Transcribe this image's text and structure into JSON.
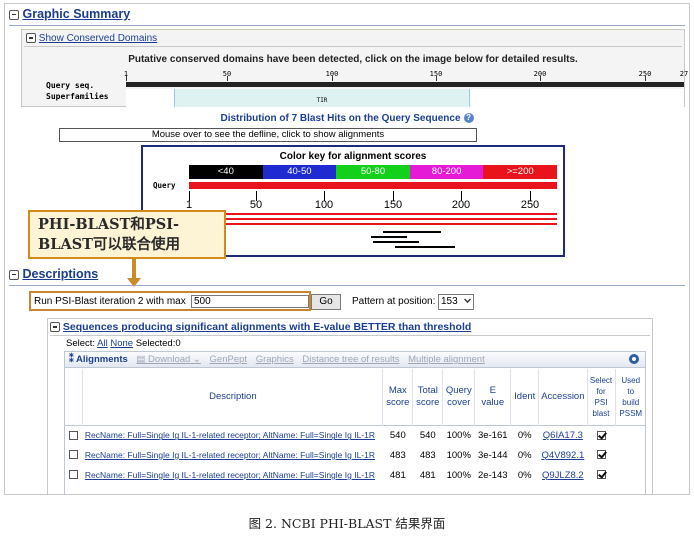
{
  "graphic_summary": {
    "title": "Graphic Summary",
    "show_conserved_domains": "Show Conserved Domains",
    "domains_note": "Putative conserved domains have been detected, click on the image below for detailed results.",
    "query_seq_label": "Query seq.",
    "superfamilies_label": "Superfamilies",
    "ruler_ticks": [
      "1",
      "50",
      "100",
      "150",
      "200",
      "250",
      "27"
    ],
    "domain_label": "TIR",
    "distribution_title": "Distribution of 7 Blast Hits on the Query Sequence",
    "mouseover_note": "Mouse over to see the defline, click to show alignments",
    "color_key_title": "Color key for alignment scores",
    "color_key": [
      {
        "label": "<40",
        "color": "#000000"
      },
      {
        "label": "40-50",
        "color": "#1f2bd1"
      },
      {
        "label": "50-80",
        "color": "#13d11a"
      },
      {
        "label": "80-200",
        "color": "#e41ad6"
      },
      {
        "label": ">=200",
        "color": "#e8131b"
      }
    ],
    "query_label": "Query",
    "axis_ticks": [
      "1",
      "50",
      "100",
      "150",
      "200",
      "250"
    ]
  },
  "callout": {
    "line1": "PHI-BLAST和PSI-",
    "line2": "BLAST可以联合使用"
  },
  "descriptions": {
    "title": "Descriptions",
    "psi_label": "Run PSI-Blast iteration 2 with max",
    "psi_value": "500",
    "go_label": "Go",
    "pattern_label": "Pattern at position:",
    "pattern_value": "153",
    "sequences_heading": "Sequences producing significant alignments with E-value BETTER than threshold",
    "select_label": "Select:",
    "select_all": "All",
    "select_none": "None",
    "selected_count": "Selected:0",
    "toolbar": {
      "alignments": "Alignments",
      "download": "Download",
      "genpept": "GenPept",
      "graphics": "Graphics",
      "distance_tree": "Distance tree of results",
      "multiple_alignment": "Multiple alignment"
    },
    "columns": {
      "description": "Description",
      "max_score_1": "Max",
      "max_score_2": "score",
      "total_score_1": "Total",
      "total_score_2": "score",
      "query_cover_1": "Query",
      "query_cover_2": "cover",
      "e_value_1": "E",
      "e_value_2": "value",
      "ident": "Ident",
      "accession": "Accession",
      "select_psi_1": "Select",
      "select_psi_2": "for",
      "select_psi_3": "PSI",
      "select_psi_4": "blast",
      "used_pssm_1": "Used",
      "used_pssm_2": "to",
      "used_pssm_3": "build",
      "used_pssm_4": "PSSM"
    },
    "rows": [
      {
        "description": "RecName: Full=Single Ig IL-1-related receptor; AltName: Full=Single Ig IL-1R",
        "max_score": "540",
        "total_score": "540",
        "query_cover": "100%",
        "e_value": "3e-161",
        "ident": "0%",
        "accession": "Q6IA17.3"
      },
      {
        "description": "RecName: Full=Single Ig IL-1-related receptor; AltName: Full=Single Ig IL-1R",
        "max_score": "483",
        "total_score": "483",
        "query_cover": "100%",
        "e_value": "3e-144",
        "ident": "0%",
        "accession": "Q4V892.1"
      },
      {
        "description": "RecName: Full=Single Ig IL-1-related receptor; AltName: Full=Single Ig IL-1R",
        "max_score": "481",
        "total_score": "481",
        "query_cover": "100%",
        "e_value": "2e-143",
        "ident": "0%",
        "accession": "Q9JLZ8.2"
      }
    ]
  },
  "caption": "图 2. NCBI PHI-BLAST 结果界面"
}
